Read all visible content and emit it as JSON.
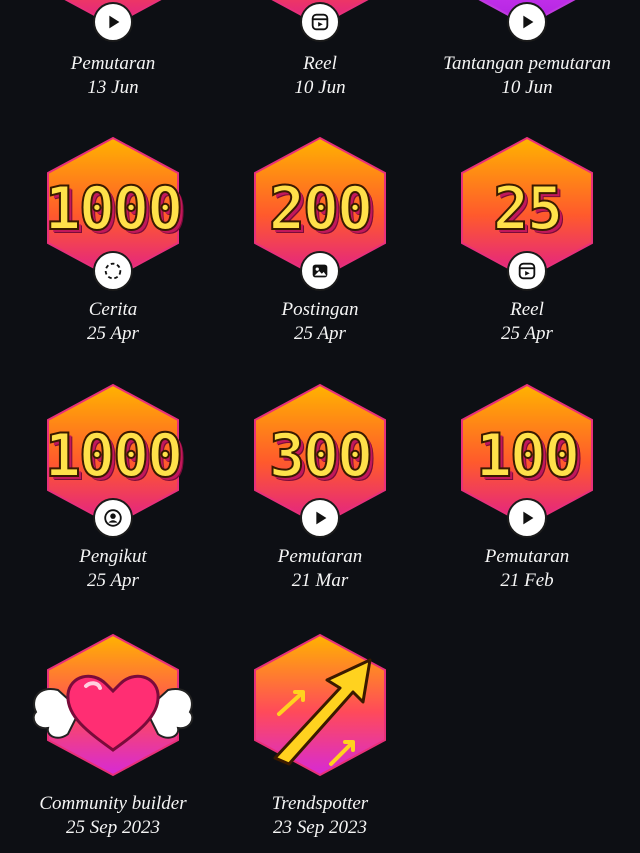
{
  "badges": [
    {
      "label": "Pemutaran",
      "date": "13 Jun",
      "icon": "play-icon"
    },
    {
      "label": "Reel",
      "date": "10 Jun",
      "icon": "reel-icon"
    },
    {
      "label": "Tantangan pemutaran",
      "date": "10 Jun",
      "icon": "play-icon"
    },
    {
      "number": "1000",
      "label": "Cerita",
      "date": "25 Apr",
      "icon": "story-icon"
    },
    {
      "number": "200",
      "label": "Postingan",
      "date": "25 Apr",
      "icon": "image-icon"
    },
    {
      "number": "25",
      "label": "Reel",
      "date": "25 Apr",
      "icon": "reel-icon"
    },
    {
      "number": "1000",
      "label": "Pengikut",
      "date": "25 Apr",
      "icon": "follower-icon"
    },
    {
      "number": "300",
      "label": "Pemutaran",
      "date": "21 Mar",
      "icon": "play-icon"
    },
    {
      "number": "100",
      "label": "Pemutaran",
      "date": "21 Feb",
      "icon": "play-icon"
    },
    {
      "label": "Community builder",
      "date": "25 Sep 2023",
      "icon": "winged-heart-icon"
    },
    {
      "label": "Trendspotter",
      "date": "23 Sep 2023",
      "icon": "trend-arrow-icon"
    }
  ]
}
